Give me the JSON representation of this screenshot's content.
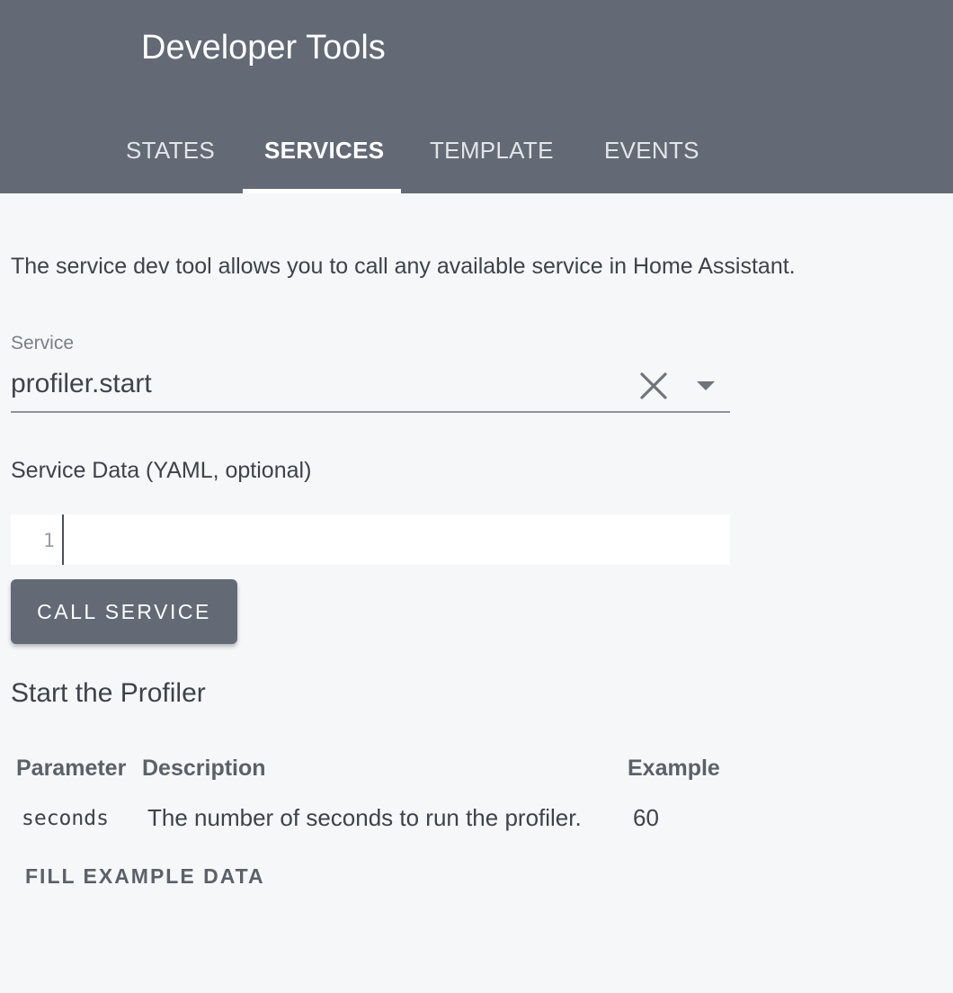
{
  "header": {
    "title": "Developer Tools",
    "tabs": [
      {
        "label": "STATES",
        "active": false
      },
      {
        "label": "SERVICES",
        "active": true
      },
      {
        "label": "TEMPLATE",
        "active": false
      },
      {
        "label": "EVENTS",
        "active": false
      }
    ]
  },
  "main": {
    "intro": "The service dev tool allows you to call any available service in Home Assistant.",
    "service_field": {
      "label": "Service",
      "value": "profiler.start"
    },
    "data_label": "Service Data (YAML, optional)",
    "editor": {
      "line_number": "1",
      "content": ""
    },
    "call_button": "CALL SERVICE",
    "section_title": "Start the Profiler",
    "table": {
      "headers": [
        "Parameter",
        "Description",
        "Example"
      ],
      "rows": [
        [
          "seconds",
          "The number of seconds to run the profiler.",
          "60"
        ]
      ]
    },
    "fill_button": "FILL EXAMPLE DATA"
  },
  "colors": {
    "header_bg": "#636a75",
    "page_bg": "#f6f7f9",
    "button_bg": "#636a75"
  },
  "icons": {
    "clear": "close-icon",
    "dropdown": "chevron-down-icon"
  }
}
